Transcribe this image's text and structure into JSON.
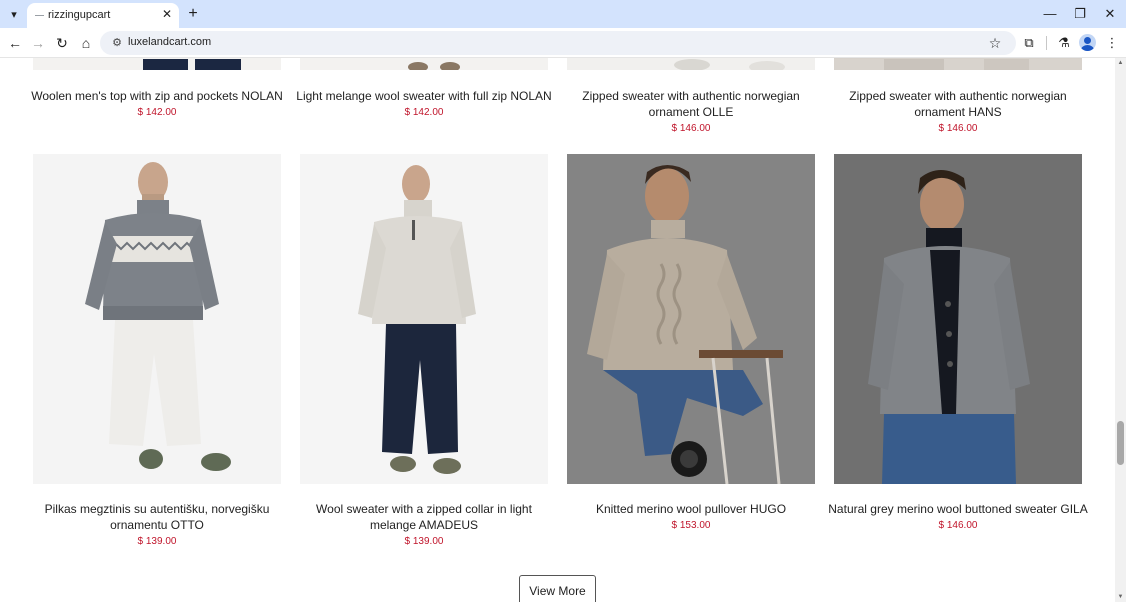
{
  "browser": {
    "tab_title": "rizzingupcart",
    "url": "luxelandcart.com",
    "icons": {
      "tab_list": "chevron-down-icon",
      "tab_close": "close-icon",
      "new_tab": "plus-icon",
      "minimize": "minimize-icon",
      "restore": "restore-icon",
      "close_window": "close-icon",
      "back": "back-arrow-icon",
      "forward": "forward-arrow-icon",
      "reload": "reload-icon",
      "home": "home-icon",
      "site_info": "tune-icon",
      "bookmark": "star-icon",
      "extensions": "puzzle-icon",
      "labs": "flask-icon",
      "profile": "avatar-icon",
      "menu": "kebab-menu-icon"
    }
  },
  "products_row_1": [
    {
      "name": "Woolen men's top with zip and pockets NOLAN",
      "price": "$ 142.00"
    },
    {
      "name": "Light melange wool sweater with full zip NOLAN",
      "price": "$ 142.00"
    },
    {
      "name": "Zipped sweater with authentic norwegian ornament OLLE",
      "price": "$ 146.00"
    },
    {
      "name": "Zipped sweater with authentic norwegian ornament HANS",
      "price": "$ 146.00"
    }
  ],
  "products_row_2": [
    {
      "name": "Pilkas megztinis su autentišku, norvegišku ornamentu OTTO",
      "price": "$ 139.00"
    },
    {
      "name": "Wool sweater with a zipped collar in light melange AMADEUS",
      "price": "$ 139.00"
    },
    {
      "name": "Knitted merino wool pullover HUGO",
      "price": "$ 153.00"
    },
    {
      "name": "Natural grey merino wool buttoned sweater GILA",
      "price": "$ 146.00"
    }
  ],
  "view_more_label": "View More",
  "colors": {
    "price": "#c0152b",
    "tab_strip": "#d3e3fd",
    "omnibox": "#eef1f7"
  }
}
